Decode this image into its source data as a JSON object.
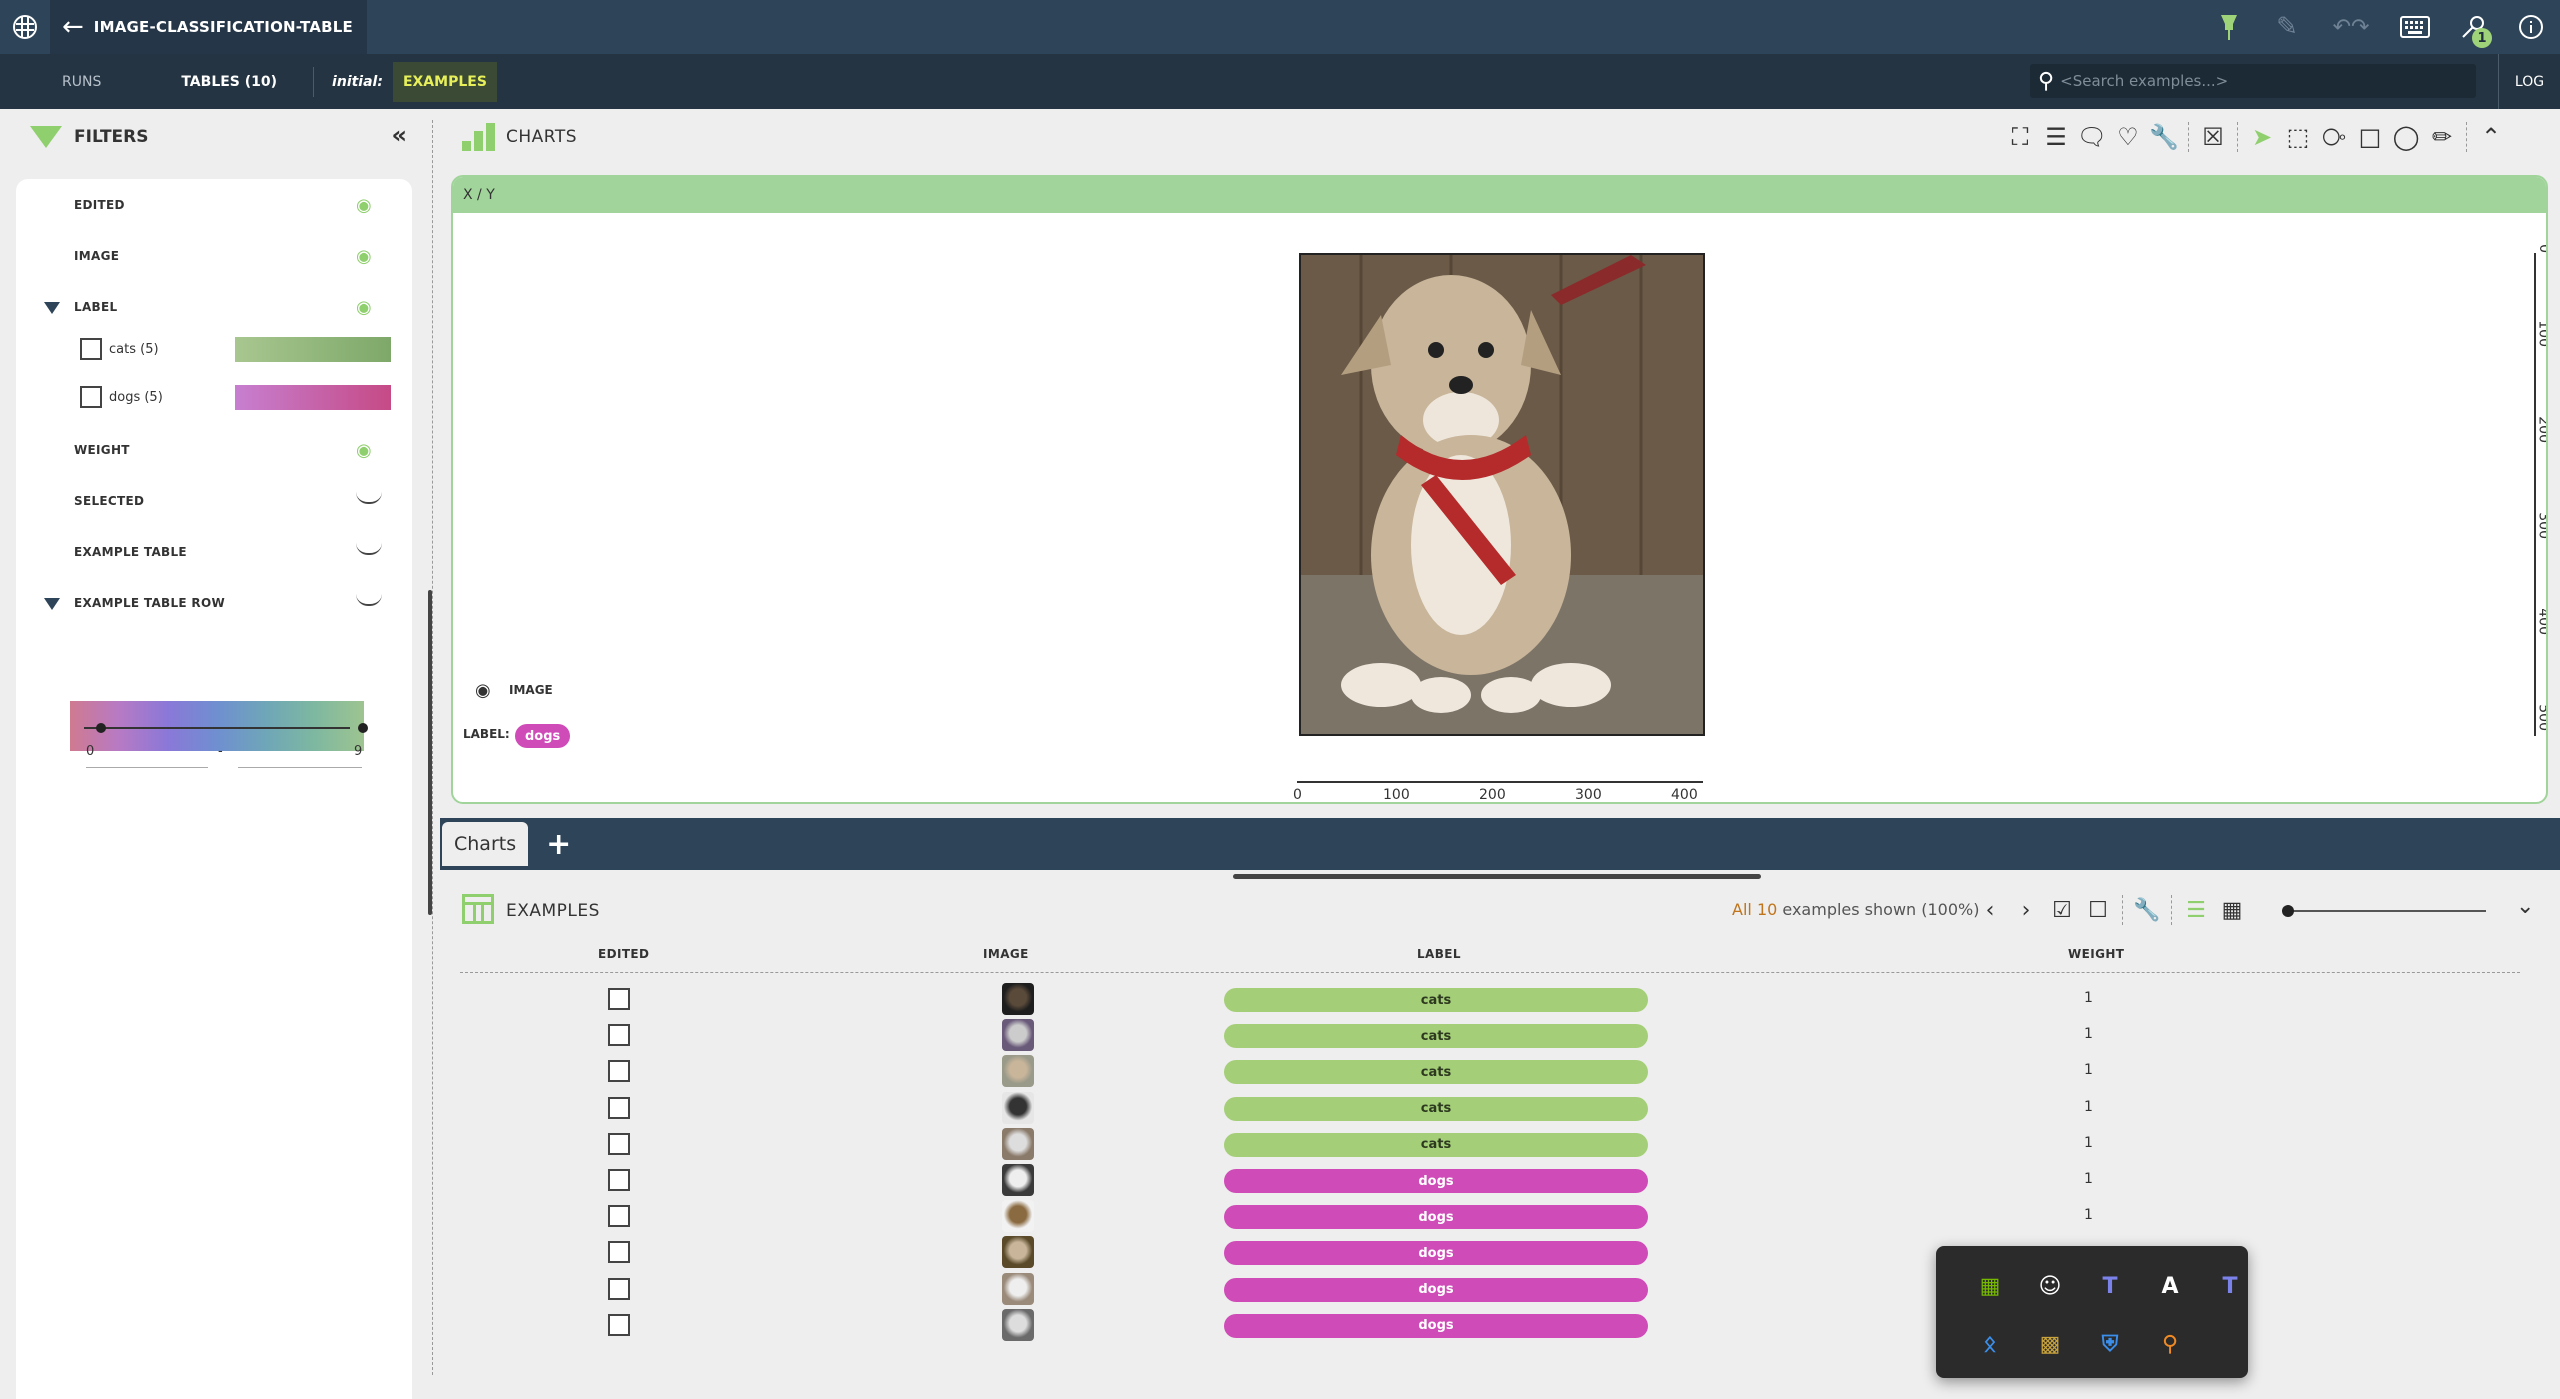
{
  "header": {
    "title": "IMAGE-CLASSIFICATION-TABLE",
    "notification_count": "1"
  },
  "nav": {
    "runs": "RUNS",
    "tables": "TABLES (10)",
    "initial": "initial:",
    "examples": "EXAMPLES",
    "search_placeholder": "<Search examples...>",
    "log": "LOG"
  },
  "filters": {
    "title": "FILTERS",
    "items": [
      {
        "label": "EDITED"
      },
      {
        "label": "IMAGE"
      },
      {
        "label": "LABEL"
      },
      {
        "label": "WEIGHT"
      },
      {
        "label": "SELECTED"
      },
      {
        "label": "EXAMPLE TABLE"
      },
      {
        "label": "EXAMPLE TABLE ROW"
      }
    ],
    "categories": [
      {
        "label": "cats (5)",
        "color": "#9ec48a"
      },
      {
        "label": "dogs (5)",
        "color": "#c978c0"
      }
    ],
    "range": {
      "min": "0",
      "dash": "-",
      "max": "9"
    }
  },
  "charts": {
    "title": "CHARTS",
    "card_title": "X / Y",
    "image_toggle": "IMAGE",
    "label_caption": "LABEL:",
    "label_value": "dogs",
    "x_ticks": [
      "0",
      "100",
      "200",
      "300",
      "400"
    ],
    "y_ticks": [
      "0",
      "100",
      "200",
      "300",
      "400",
      "500"
    ]
  },
  "tabs": {
    "charts": "Charts",
    "add": "+"
  },
  "examples": {
    "title": "EXAMPLES",
    "shown_all": "All",
    "shown_count": "10",
    "shown_rest": "examples shown (100%)",
    "columns": [
      "EDITED",
      "IMAGE",
      "LABEL",
      "WEIGHT"
    ],
    "rows": [
      {
        "label": "cats",
        "weight": "1"
      },
      {
        "label": "cats",
        "weight": "1"
      },
      {
        "label": "cats",
        "weight": "1"
      },
      {
        "label": "cats",
        "weight": "1"
      },
      {
        "label": "cats",
        "weight": "1"
      },
      {
        "label": "dogs",
        "weight": "1"
      },
      {
        "label": "dogs",
        "weight": "1"
      },
      {
        "label": "dogs",
        "weight": ""
      },
      {
        "label": "dogs",
        "weight": ""
      },
      {
        "label": "dogs",
        "weight": ""
      }
    ]
  },
  "colors": {
    "cats": "#a4cf78",
    "dogs": "#cf4bb8",
    "accent": "#8fcf6e",
    "header_bg": "#2e4459"
  }
}
